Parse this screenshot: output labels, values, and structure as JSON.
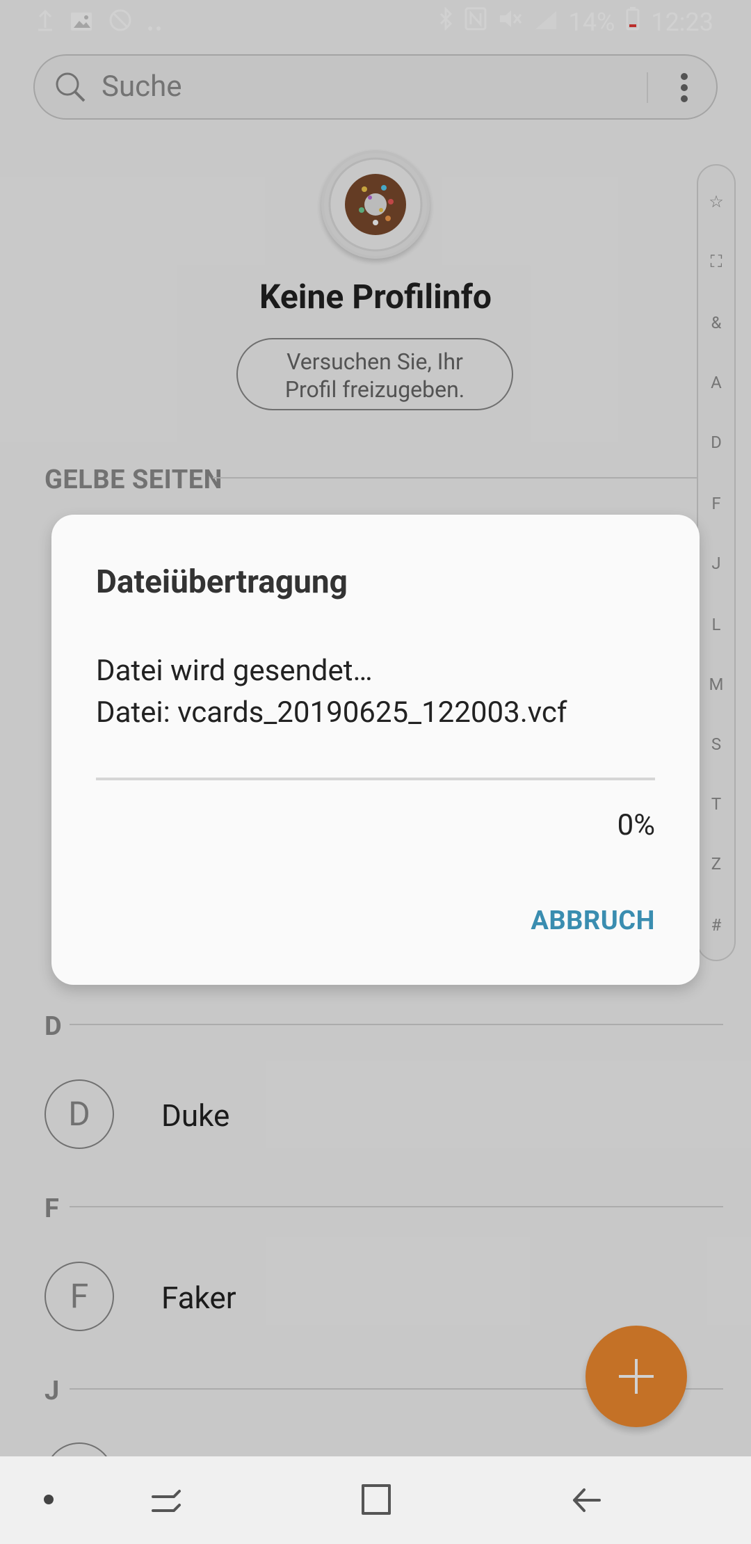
{
  "status_bar": {
    "battery_percent": "14%",
    "time": "12:23",
    "icons": [
      "upload-icon",
      "gallery-icon",
      "block-icon",
      "more-icon",
      "bluetooth-icon",
      "nfc-icon",
      "mute-icon",
      "signal-icon",
      "battery-icon"
    ]
  },
  "search": {
    "placeholder": "Suche"
  },
  "profile": {
    "title": "Keine Profilinfo",
    "share_prompt_line1": "Versuchen Sie, Ihr",
    "share_prompt_line2": "Profil freizugeben."
  },
  "sections": {
    "yellow_pages": "GELBE SEITEN",
    "d_header": "D",
    "f_header": "F",
    "j_header": "J"
  },
  "contacts": [
    {
      "initial": "D",
      "name": "Duke"
    },
    {
      "initial": "F",
      "name": "Faker"
    }
  ],
  "index_letters": [
    "☆",
    "⛶",
    "&",
    "A",
    "D",
    "F",
    "J",
    "L",
    "M",
    "S",
    "T",
    "Z",
    "#"
  ],
  "dialog": {
    "title": "Dateiübertragung",
    "message_line1": "Datei wird gesendet…",
    "message_line2": "Datei: vcards_20190625_122003.vcf",
    "progress_percent": "0%",
    "progress_value": 0,
    "cancel_label": "ABBRUCH"
  },
  "fab": {
    "icon": "plus-icon"
  },
  "colors": {
    "accent": "#3a8db0",
    "fab": "#f08a2f"
  }
}
